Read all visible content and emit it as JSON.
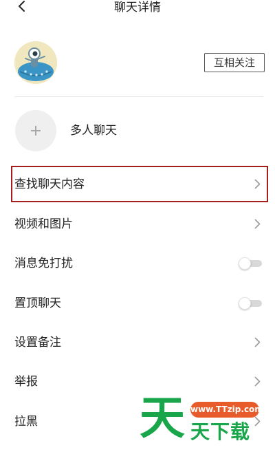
{
  "header": {
    "title": "聊天详情",
    "back_icon": "chevron-left-icon"
  },
  "profile": {
    "avatar_icon": "alien-avatar",
    "follow_label": "互相关注"
  },
  "group": {
    "add_icon": "plus-icon",
    "label": "多人聊天"
  },
  "settings": {
    "search_chat": "查找聊天内容",
    "media": "视频和图片",
    "do_not_disturb": "消息免打扰",
    "do_not_disturb_on": false,
    "pin_chat": "置顶聊天",
    "pin_chat_on": false,
    "set_remark": "设置备注",
    "report": "举报",
    "block": "拉黑"
  },
  "watermark": {
    "big_char": "天",
    "url": "www.TTzip.com",
    "text": "天下载"
  },
  "colors": {
    "highlight": "#a51d1d",
    "watermark_green": "#19a64b",
    "watermark_orange": "#e85b2a"
  }
}
